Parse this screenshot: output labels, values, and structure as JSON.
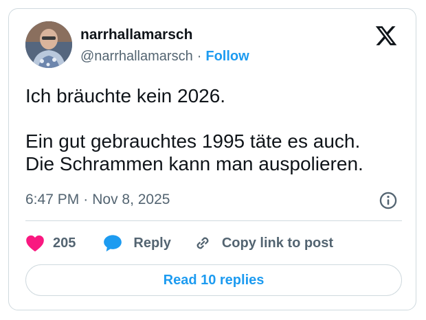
{
  "author": {
    "display_name": "narrhallamarsch",
    "handle": "@narrhallamarsch",
    "follow_label": "Follow"
  },
  "tweet": {
    "lines": [
      "Ich bräuchte kein 2026.",
      "Ein gut gebrauchtes 1995 täte es auch.",
      "Die Schrammen kann man auspolieren."
    ],
    "time": "6:47 PM",
    "date": "Nov 8, 2025"
  },
  "actions": {
    "like_count": "205",
    "reply_label": "Reply",
    "copy_label": "Copy link to post"
  },
  "read_replies_label": "Read 10 replies",
  "icons": {
    "brand": "x-logo-icon",
    "info": "info-icon",
    "like": "heart-icon",
    "reply": "speech-bubble-icon",
    "copy": "link-icon"
  },
  "colors": {
    "accent": "#1d9bf0",
    "like": "#f91880",
    "text": "#0f1419",
    "muted": "#536471",
    "border": "#cfd9de"
  }
}
